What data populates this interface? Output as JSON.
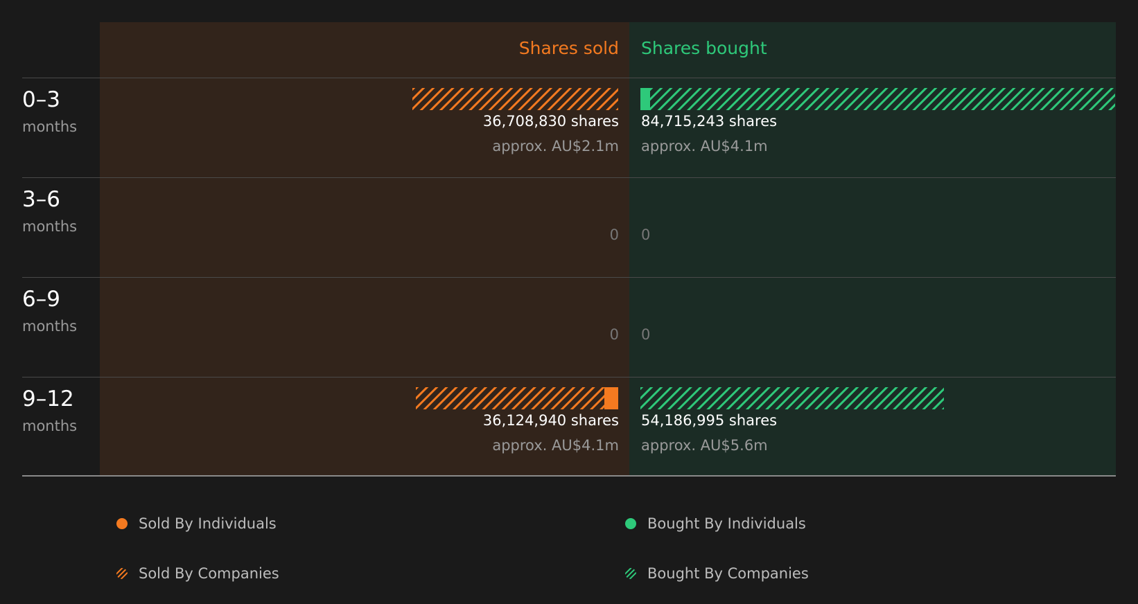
{
  "colors": {
    "sold": "#f47a20",
    "bought": "#2ec97a"
  },
  "chart_data": {
    "type": "bar",
    "title": "",
    "headers": {
      "sold": "Shares sold",
      "bought": "Shares bought"
    },
    "categories": [
      {
        "period": "0–3",
        "unit": "months"
      },
      {
        "period": "3–6",
        "unit": "months"
      },
      {
        "period": "6–9",
        "unit": "months"
      },
      {
        "period": "9–12",
        "unit": "months"
      }
    ],
    "max_shares": 84715243,
    "sold": [
      {
        "shares": 36708830,
        "label": "36,708,830 shares",
        "approx": "approx. AU$2.1m",
        "individuals_fraction": 0.0
      },
      {
        "shares": 0,
        "label": "0",
        "approx": "",
        "individuals_fraction": 0.0
      },
      {
        "shares": 0,
        "label": "0",
        "approx": "",
        "individuals_fraction": 0.0
      },
      {
        "shares": 36124940,
        "label": "36,124,940 shares",
        "approx": "approx. AU$4.1m",
        "individuals_fraction": 0.07
      }
    ],
    "bought": [
      {
        "shares": 84715243,
        "label": "84,715,243 shares",
        "approx": "approx. AU$4.1m",
        "individuals_fraction": 0.02
      },
      {
        "shares": 0,
        "label": "0",
        "approx": "",
        "individuals_fraction": 0.0
      },
      {
        "shares": 0,
        "label": "0",
        "approx": "",
        "individuals_fraction": 0.0
      },
      {
        "shares": 54186995,
        "label": "54,186,995 shares",
        "approx": "approx. AU$5.6m",
        "individuals_fraction": 0.0
      }
    ],
    "legend": {
      "sold_individuals": "Sold By Individuals",
      "sold_companies": "Sold By Companies",
      "bought_individuals": "Bought By Individuals",
      "bought_companies": "Bought By Companies"
    }
  }
}
